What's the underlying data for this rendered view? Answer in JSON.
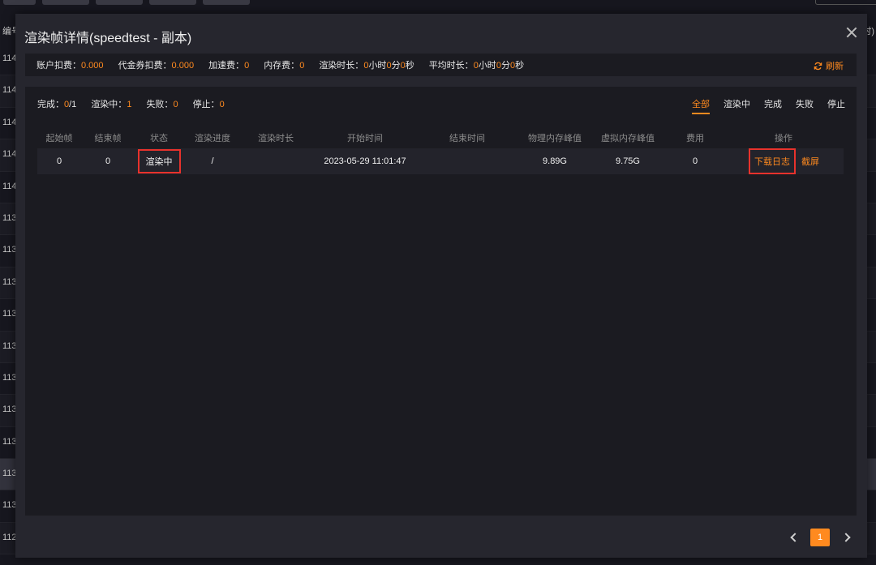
{
  "background": {
    "col_header_left": "编号",
    "col_header_right": "(时)",
    "row_ids": [
      "114",
      "114",
      "114",
      "114",
      "114",
      "113",
      "113",
      "113",
      "113",
      "113",
      "113",
      "113",
      "113",
      "113",
      "113",
      "112"
    ]
  },
  "modal": {
    "title": "渲染帧详情(speedtest - 副本)",
    "close_icon": "close-icon"
  },
  "info": {
    "account_label": "账户扣费：",
    "account_value": "0.000",
    "voucher_label": "代金券扣费：",
    "voucher_value": "0.000",
    "accel_label": "加速费：",
    "accel_value": "0",
    "mem_label": "内存费：",
    "mem_value": "0",
    "render_time_label": "渲染时长：",
    "render_h": "0",
    "render_m": "0",
    "render_s": "0",
    "avg_time_label": "平均时长：",
    "avg_h": "0",
    "avg_m": "0",
    "avg_s": "0",
    "unit_h": "小时",
    "unit_m": "分",
    "unit_s": "秒",
    "refresh_label": "刷新",
    "refresh_icon": "refresh-icon"
  },
  "stats": {
    "done_label": "完成：",
    "done_value": "0",
    "done_total": "/1",
    "rendering_label": "渲染中：",
    "rendering_value": "1",
    "failed_label": "失败：",
    "failed_value": "0",
    "stopped_label": "停止：",
    "stopped_value": "0"
  },
  "filters": [
    "全部",
    "渲染中",
    "完成",
    "失败",
    "停止"
  ],
  "active_filter": "全部",
  "table": {
    "headers": [
      "起始帧",
      "结束帧",
      "状态",
      "渲染进度",
      "渲染时长",
      "开始时间",
      "结束时间",
      "物理内存峰值",
      "虚拟内存峰值",
      "费用",
      "操作"
    ],
    "row": {
      "start_frame": "0",
      "end_frame": "0",
      "status": "渲染中",
      "progress": "/",
      "duration": "",
      "start_time": "2023-05-29 11:01:47",
      "end_time": "",
      "phys_mem": "9.89G",
      "virt_mem": "9.75G",
      "cost": "0",
      "op_download": "下载日志",
      "op_screenshot": "截屏"
    }
  },
  "pagination": {
    "current_page": "1"
  },
  "colors": {
    "accent": "#ff8a1f",
    "highlight_box": "#e8322c"
  }
}
